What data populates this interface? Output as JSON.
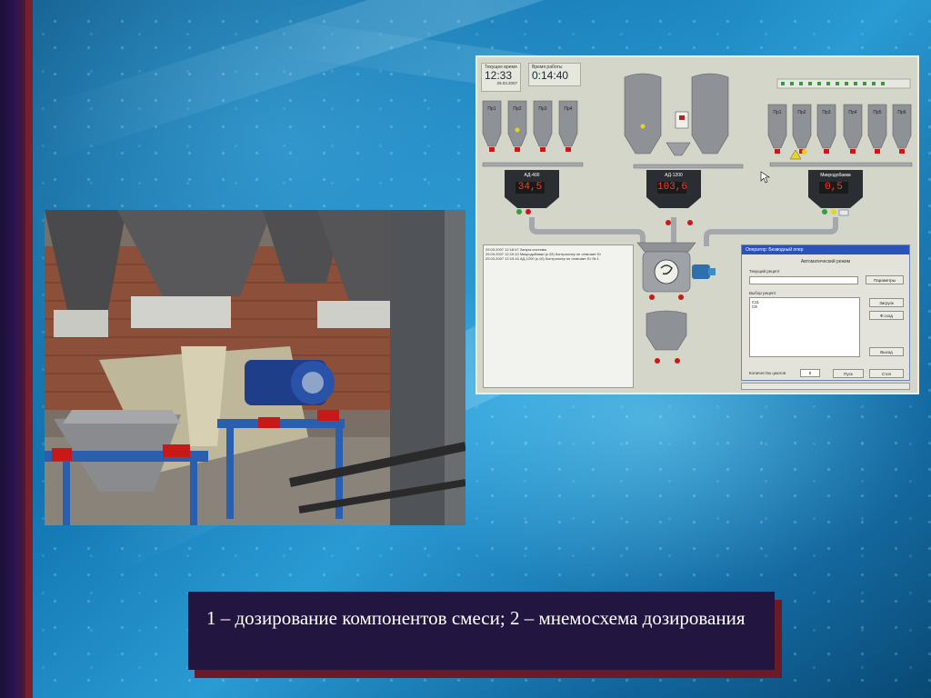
{
  "caption": {
    "text": "1 – дозирование компонентов смеси; 2 – мнемосхема дозирования"
  },
  "hmi": {
    "current_time_label": "Текущее время",
    "current_time": "12:33",
    "date": "29.03.2007",
    "work_time_label": "Время работы",
    "work_time": "0:14:40",
    "left_hoppers": [
      "Пр1",
      "Пр2",
      "Пр3",
      "Пр4"
    ],
    "right_hoppers": [
      "Пр1",
      "Пр2",
      "Пр3",
      "Пр4",
      "Пр5",
      "Пр6"
    ],
    "scales": [
      {
        "title": "АД-400",
        "value": "34,5"
      },
      {
        "title": "АД-1200",
        "value": "103,6"
      },
      {
        "title": "Микродобавки",
        "value": "0,5"
      }
    ],
    "log_lines": [
      "29.03.2007 12:18:47 Запуск системы",
      "29.03.2007 12:19:10 Микродобавки (к.33) Контроллер не отвечает Ег",
      "29.03.2007 12:19:16 АД-1200 (к.10) Контроллер не отвечает Ег № 1"
    ],
    "dialog": {
      "title": "Оператор: Безводный опер",
      "mode": "Автоматический режим",
      "current_recipe_label": "Текущий рецепт",
      "params_button": "Параметры",
      "select_recipe_label": "Выбор рецепт",
      "recipes": [
        "С11",
        "С8"
      ],
      "load_button": "Загрузк",
      "create_button": "Ф.созд",
      "exit_button": "Выход",
      "cycles_label": "Количество циклов",
      "cycles_value": "0",
      "start_button": "Пуск",
      "stop_button": "Стоп"
    }
  },
  "colors": {
    "caption_bg": "#221641",
    "caption_shadow": "#6b1a28",
    "scale_display": "#ff3a2a",
    "hmi_bg": "#d4d6c9",
    "dialog_title": "#2a52b8"
  }
}
